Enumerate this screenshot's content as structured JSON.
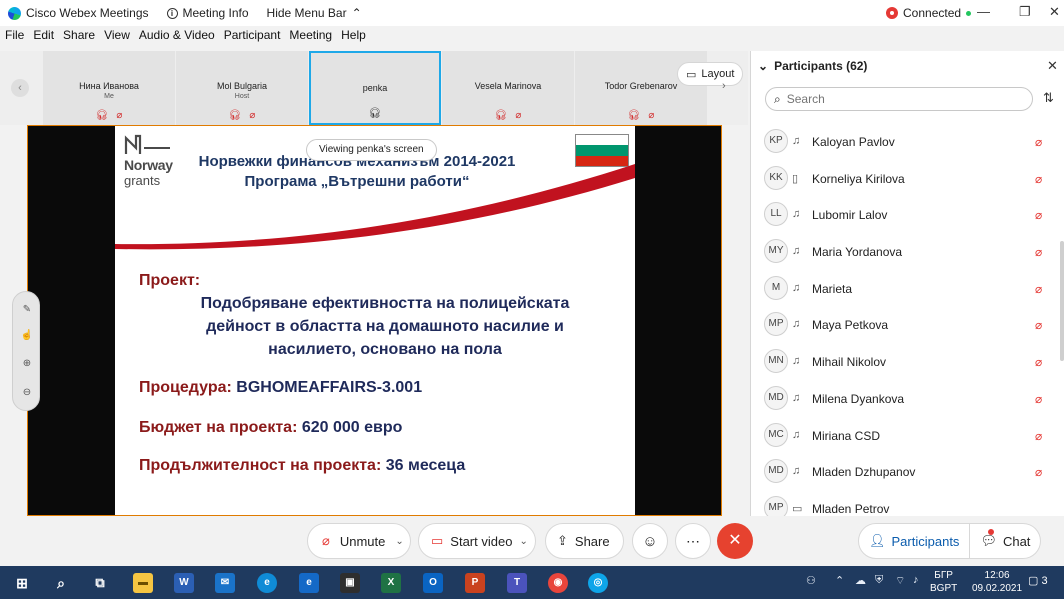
{
  "titlebar": {
    "app_name": "Cisco Webex Meetings",
    "meeting_info": "Meeting Info",
    "hide_menu": "Hide Menu Bar",
    "status": "Connected"
  },
  "menu": [
    "File",
    "Edit",
    "Share",
    "View",
    "Audio & Video",
    "Participant",
    "Meeting",
    "Help"
  ],
  "filmstrip": [
    {
      "name": "Нина Иванова",
      "role": "Me"
    },
    {
      "name": "Mol Bulgaria",
      "role": "Host"
    },
    {
      "name": "penka",
      "role": ""
    },
    {
      "name": "Vesela Marinova",
      "role": ""
    },
    {
      "name": "Todor Grebenarov",
      "role": ""
    }
  ],
  "layout_label": "Layout",
  "viewing_label": "Viewing penka's screen",
  "slide": {
    "logo_word1": "Norway",
    "logo_word2": "grants",
    "title1": "Норвежки финансов механизъм 2014-2021",
    "title2": "Програма „Вътрешни работи“",
    "project_label": "Проект:",
    "project_desc1": "Подобряване ефективността на полицейската",
    "project_desc2": "дейност в областта на домашното насилие и",
    "project_desc3": "насилието, основано на пола",
    "procedure_label": "Процедура:",
    "procedure_value": "BGHOMEAFFAIRS-3.001",
    "budget_label": "Бюджет на проекта:",
    "budget_value": "620 000 евро",
    "duration_label": "Продължителност на проекта:",
    "duration_value": "36 месеца"
  },
  "controls": {
    "unmute": "Unmute",
    "start_video": "Start video",
    "share": "Share",
    "participants": "Participants",
    "chat": "Chat"
  },
  "panel": {
    "title": "Participants (62)",
    "search_placeholder": "Search",
    "participants": [
      {
        "initials": "KP",
        "name": "Kaloyan Pavlov"
      },
      {
        "initials": "KK",
        "name": "Korneliya Kirilova"
      },
      {
        "initials": "LL",
        "name": "Lubomir Lalov"
      },
      {
        "initials": "MY",
        "name": "Maria Yordanova"
      },
      {
        "initials": "M",
        "name": "Marieta"
      },
      {
        "initials": "MP",
        "name": "Maya Petkova"
      },
      {
        "initials": "MN",
        "name": "Mihail Nikolov"
      },
      {
        "initials": "MD",
        "name": "Milena Dyankova"
      },
      {
        "initials": "MC",
        "name": "Miriana CSD"
      },
      {
        "initials": "MD",
        "name": "Mladen Dzhupanov"
      },
      {
        "initials": "MP",
        "name": "Mladen Petrov"
      }
    ]
  },
  "taskbar": {
    "lang_top": "БГР",
    "lang_bottom": "BGPT",
    "time": "12:06",
    "date": "09.02.2021",
    "notifications": "3"
  },
  "colors": {
    "accent_blue": "#1ea8e8",
    "leave_red": "#e6422f",
    "slide_red": "#8b1a1a",
    "slide_blue": "#1f3864"
  }
}
